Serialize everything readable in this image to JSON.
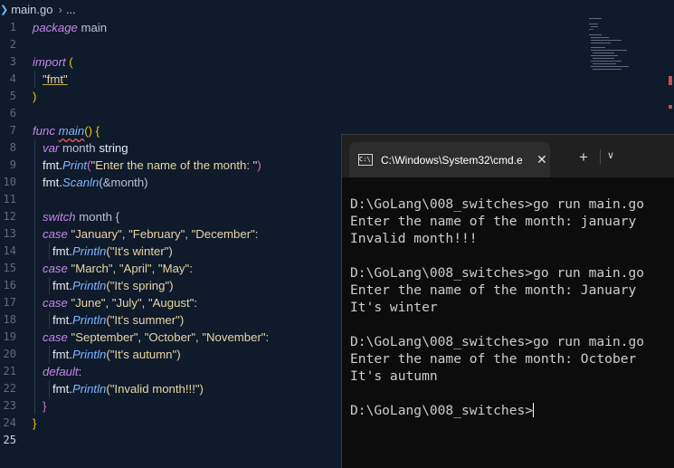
{
  "editor": {
    "breadcrumb": {
      "file": "main.go",
      "more": "..."
    },
    "line_numbers": [
      "1",
      "2",
      "3",
      "4",
      "5",
      "6",
      "7",
      "8",
      "9",
      "10",
      "11",
      "12",
      "13",
      "14",
      "15",
      "16",
      "17",
      "18",
      "19",
      "20",
      "21",
      "22",
      "23",
      "24",
      "25"
    ],
    "code": {
      "l1_kw": "package",
      "l1_name": " main",
      "l3_kw": "import",
      "l3_paren": " (",
      "l4_str": "\"fmt\"",
      "l5_paren": ")",
      "l7_kw": "func",
      "l7_fn": "main",
      "l7_rest": "() {",
      "l8_kw": "var",
      "l8_name": " month",
      "l8_type": " string",
      "l9_pkg": "fmt.",
      "l9_fn": "Print",
      "l9_open": "(",
      "l9_str": "\"Enter the name of the month: \"",
      "l9_close": ")",
      "l10_pkg": "fmt.",
      "l10_fn": "Scanln",
      "l10_rest": "(&month)",
      "l12_kw": "switch",
      "l12_rest": " month {",
      "l13_kw": "case",
      "l13_rest": " \"January\", \"February\", \"December\":",
      "l14_pkg": "fmt.",
      "l14_fn": "Println",
      "l14_rest": "(\"It's winter\")",
      "l15_kw": "case",
      "l15_rest": " \"March\", \"April\", \"May\":",
      "l16_pkg": "fmt.",
      "l16_fn": "Println",
      "l16_rest": "(\"It's spring\")",
      "l17_kw": "case",
      "l17_rest": " \"June\", \"July\", \"August\":",
      "l18_pkg": "fmt.",
      "l18_fn": "Println",
      "l18_rest": "(\"It's summer\")",
      "l19_kw": "case",
      "l19_rest": " \"September\", \"October\", \"November\":",
      "l20_pkg": "fmt.",
      "l20_fn": "Println",
      "l20_rest": "(\"It's autumn\")",
      "l21_kw": "default",
      "l21_rest": ":",
      "l22_pkg": "fmt.",
      "l22_fn": "Println",
      "l22_rest": "(\"Invalid month!!!\")",
      "l23_brace": "}",
      "l24_brace": "}"
    }
  },
  "terminal": {
    "tab_title": "C:\\Windows\\System32\\cmd.e",
    "new_tab": "+",
    "lines": [
      "D:\\GoLang\\008_switches>go run main.go",
      "Enter the name of the month: january",
      "Invalid month!!!",
      "",
      "D:\\GoLang\\008_switches>go run main.go",
      "Enter the name of the month: January",
      "It's winter",
      "",
      "D:\\GoLang\\008_switches>go run main.go",
      "Enter the name of the month: October",
      "It's autumn",
      ""
    ],
    "prompt": "D:\\GoLang\\008_switches>"
  }
}
